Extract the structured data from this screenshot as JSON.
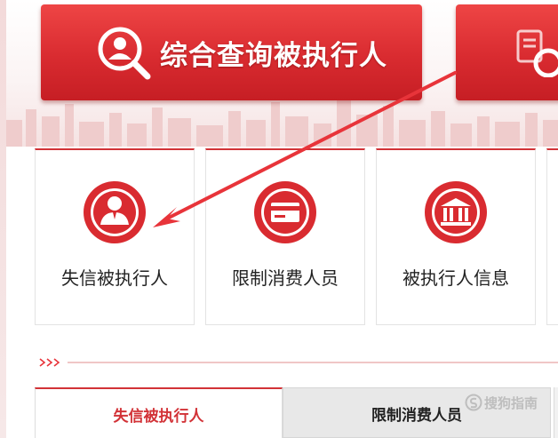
{
  "banner": {
    "main_button": {
      "label": "综合查询被执行人",
      "icon": "search-person-icon"
    },
    "second_button": {
      "icon": "document-search-icon"
    }
  },
  "categories": [
    {
      "label": "失信被执行人",
      "icon": "person-icon"
    },
    {
      "label": "限制消费人员",
      "icon": "card-icon"
    },
    {
      "label": "被执行人信息",
      "icon": "courthouse-icon"
    }
  ],
  "tabs": [
    {
      "label": "失信被执行人",
      "active": true
    },
    {
      "label": "限制消费人员",
      "active": false
    }
  ],
  "watermark": {
    "text": "搜狗指南"
  },
  "colors": {
    "brand_red": "#d92b30",
    "arrow_red": "#e8343a",
    "text_dark": "#222222",
    "tab_inactive_bg": "#e8e8e8"
  }
}
